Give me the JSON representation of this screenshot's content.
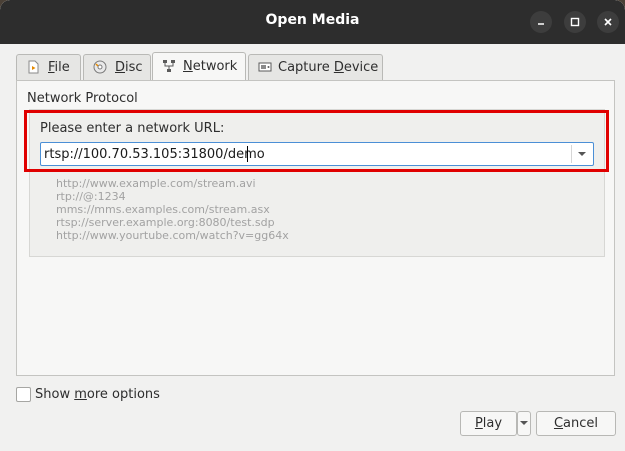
{
  "window": {
    "title": "Open Media",
    "controls": [
      "minimize",
      "maximize",
      "close"
    ]
  },
  "tabs": [
    {
      "pre": "",
      "mnemonic": "F",
      "post": "ile",
      "icon": "file-icon",
      "active": false
    },
    {
      "pre": "",
      "mnemonic": "D",
      "post": "isc",
      "icon": "disc-icon",
      "active": false
    },
    {
      "pre": "",
      "mnemonic": "N",
      "post": "etwork",
      "icon": "network-icon",
      "active": true
    },
    {
      "pre": "Capture ",
      "mnemonic": "D",
      "post": "evice",
      "icon": "capture-device-icon",
      "active": false
    }
  ],
  "network": {
    "group_title": "Network Protocol",
    "url_label": "Please enter a network URL:",
    "url_value": "rtsp://100.70.53.105:31800/demo",
    "examples": [
      "http://www.example.com/stream.avi",
      "rtp://@:1234",
      "mms://mms.examples.com/stream.asx",
      "rtsp://server.example.org:8080/test.sdp",
      "http://www.yourtube.com/watch?v=gg64x"
    ]
  },
  "options": {
    "show_more_pre": "Show ",
    "show_more_mnemonic": "m",
    "show_more_post": "ore options",
    "checked": false
  },
  "buttons": {
    "play_mnemonic": "P",
    "play_rest": "lay",
    "cancel_mnemonic": "C",
    "cancel_rest": "ancel"
  },
  "colors": {
    "titlebar": "#2d2d2d",
    "highlight": "#e00000",
    "focus": "#4b8fd6"
  }
}
